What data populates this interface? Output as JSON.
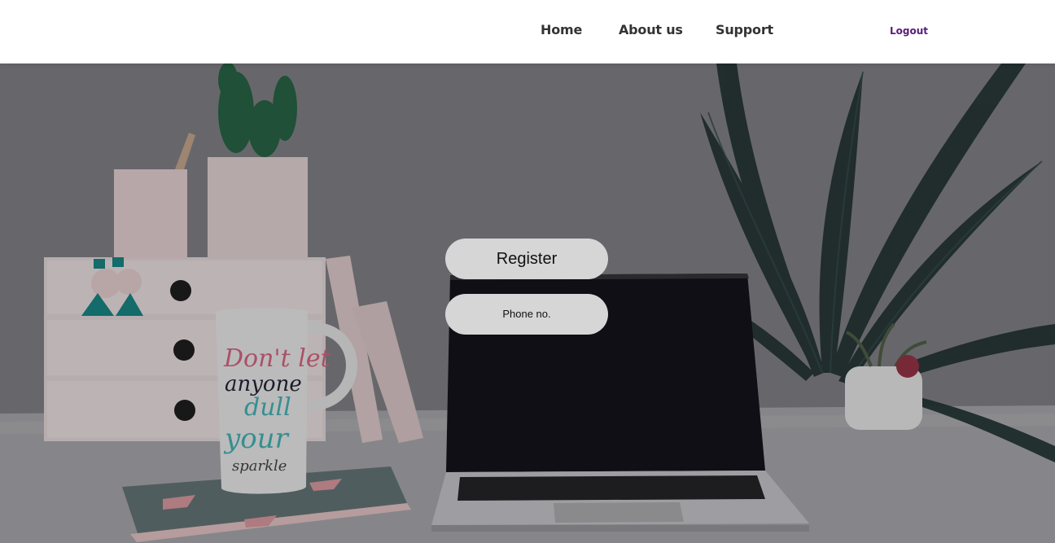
{
  "nav": {
    "home_label": "Home",
    "about_label": "About us",
    "support_label": "Support",
    "logout_label": "Logout"
  },
  "actions": {
    "register_label": "Register",
    "phone_label": "Phone no."
  },
  "mug": {
    "lines": [
      "Don't let",
      "anyone",
      "dull",
      "your",
      "sparkle"
    ]
  },
  "colors": {
    "nav_text": "#333333",
    "logout_text": "#5a1c7a",
    "pill_background": "#d6d6d6"
  },
  "icons": {
    "hero_background": "desk-workspace-photo"
  }
}
